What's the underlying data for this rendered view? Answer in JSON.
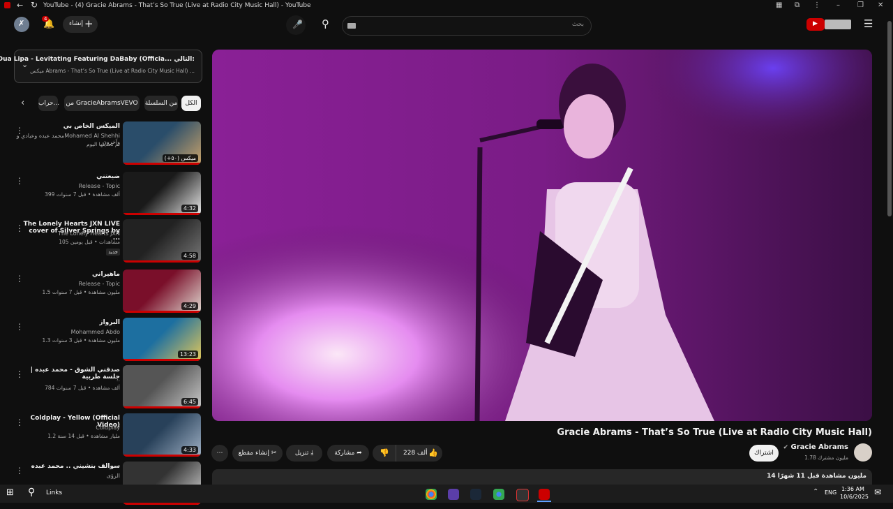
{
  "window": {
    "title": "YouTube - (4) Gracie Abrams - That’s So True (Live at Radio City Music Hall) - YouTube"
  },
  "header": {
    "create_label": "إنشاء",
    "notification_count": "4",
    "search_placeholder": "بحث"
  },
  "up_next": {
    "label": "التالي:",
    "title": "Dua Lipa - Levitating Featuring DaBaby (Officia...",
    "subtitle": "ميكس Abrams - That’s So True (Live at Radio City Music Hall) ..."
  },
  "chips": [
    "الكل",
    "من السلسلة",
    "من GracieAbramsVEVO",
    "حراب..."
  ],
  "playlist": [
    {
      "title": "الميكس الخاص بي",
      "channel": "محمد عبده وعبادي وMohamed Al Shehhi وآخرون",
      "meta": "تم تحديثها اليوم",
      "duration": "(+٥٠) ميكس",
      "colors": [
        "#2a4d6a",
        "#c9a36b"
      ]
    },
    {
      "title": "ضيعتني",
      "channel": "Release - Topic",
      "meta": "399 ألف مشاهدة • قبل 7 سنوات",
      "duration": "4:32",
      "colors": [
        "#1a1a1a",
        "#e8e8e8"
      ]
    },
    {
      "title": "The Lonely Hearts JXN LIVE cover of Silver Springs by ...",
      "channel": "The Lonely Hearts JXN",
      "meta": "105 مشاهدات • قبل يومين",
      "badge": "جديد",
      "duration": "4:58",
      "colors": [
        "#222",
        "#777"
      ]
    },
    {
      "title": "ماهيراني",
      "channel": "Release - Topic",
      "meta": "1.5 مليون مشاهدة • قبل 7 سنوات",
      "duration": "4:29",
      "colors": [
        "#7a0f2a",
        "#e0d8d0"
      ]
    },
    {
      "title": "البرواز",
      "channel": "Mohammed Abdo",
      "meta": "1.3 مليون مشاهدة • قبل 3 سنوات",
      "duration": "13:23",
      "colors": [
        "#1d6fa0",
        "#e3c85a"
      ]
    },
    {
      "title": "صدقني الشوق - محمد عبده | جلسة طربية",
      "channel": "..",
      "meta": "784 ألف مشاهدة • قبل 7 سنوات",
      "duration": "6:45",
      "colors": [
        "#555",
        "#c8c8c8"
      ]
    },
    {
      "title": "Coldplay - Yellow (Official Video)",
      "channel": "Coldplay",
      "meta": "1.2 مليار مشاهدة • قبل 14 سنة",
      "duration": "4:33",
      "colors": [
        "#28415a",
        "#9fb0c4"
      ]
    },
    {
      "title": "سوالف بنشيني .. محمد عبده",
      "channel": "الرؤى",
      "meta": "",
      "duration": "",
      "colors": [
        "#333",
        "#d8d8d8"
      ]
    }
  ],
  "video": {
    "title": "Gracie Abrams - That’s So True (Live at Radio City Music Hall)",
    "channel": "Gracie Abrams",
    "subscribers": "1.78 مليون مشترك",
    "subscribe_label": "اشتراك",
    "likes": "228 ألف",
    "share_label": "مشاركة",
    "download_label": "تنزيل",
    "clip_label": "إنشاء مقطع",
    "views_meta": "14 مليون مشاهدة  قبل 11 شهرًا",
    "colors": {
      "bg": "#5a145e",
      "light": "#f6e9f2",
      "glow": "#c957d6"
    }
  },
  "taskbar": {
    "search_label": "Links",
    "lang": "ENG",
    "time": "1:36 AM",
    "date": "10/6/2025"
  }
}
